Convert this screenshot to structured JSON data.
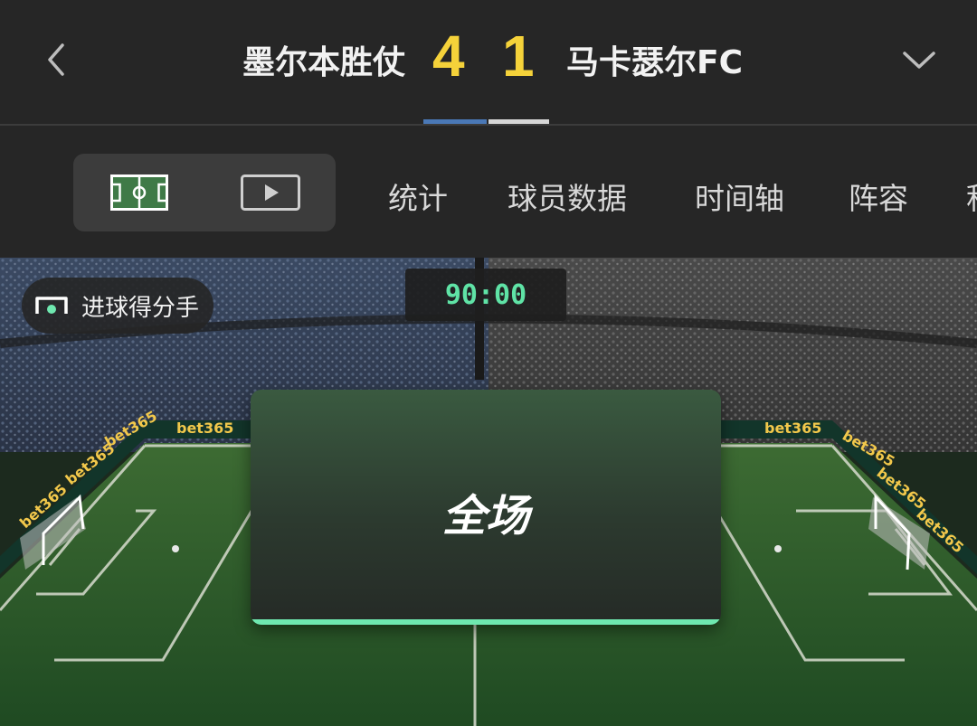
{
  "header": {
    "home_team": "墨尔本胜仗",
    "home_score": "4",
    "away_score": "1",
    "away_team": "马卡瑟尔FC",
    "back_icon": "chevron-left-icon",
    "collapse_icon": "chevron-down-icon",
    "colors": {
      "score": "#f5d23a",
      "home": "#4a78b6",
      "away": "#d6d6d6"
    }
  },
  "tabs": {
    "view_toggle": [
      {
        "icon": "pitch-icon",
        "selected": true
      },
      {
        "icon": "play-video-icon",
        "selected": false
      }
    ],
    "items": [
      "统计",
      "球员数据",
      "时间轴",
      "阵容",
      "积"
    ]
  },
  "match": {
    "scorer_label": "进球得分手",
    "scorer_icon": "goal-net-icon",
    "clock": "90:00",
    "status": "全场",
    "sponsor": "bet365",
    "colors": {
      "clock": "#5fe3a6",
      "status_bar": "#6fe8b0",
      "sponsor": "#f2c84b"
    }
  }
}
